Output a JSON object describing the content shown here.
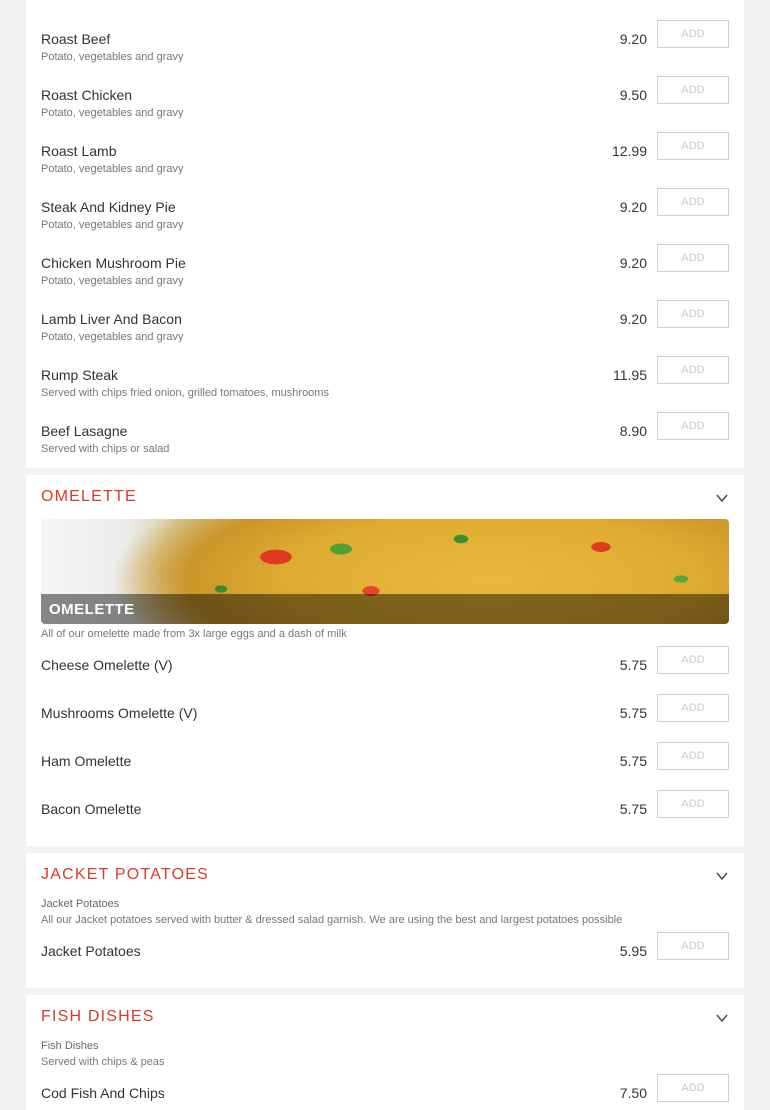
{
  "roast_section": {
    "items": [
      {
        "name": "Roast Beef",
        "desc": "Potato, vegetables and gravy",
        "price": "9.20",
        "add": "ADD"
      },
      {
        "name": "Roast Chicken",
        "desc": "Potato, vegetables and gravy",
        "price": "9.50",
        "add": "ADD"
      },
      {
        "name": "Roast Lamb",
        "desc": "Potato, vegetables and gravy",
        "price": "12.99",
        "add": "ADD"
      },
      {
        "name": "Steak And Kidney Pie",
        "desc": "Potato, vegetables and gravy",
        "price": "9.20",
        "add": "ADD"
      },
      {
        "name": "Chicken Mushroom Pie",
        "desc": "Potato, vegetables and gravy",
        "price": "9.20",
        "add": "ADD"
      },
      {
        "name": "Lamb Liver And Bacon",
        "desc": "Potato, vegetables and gravy",
        "price": "9.20",
        "add": "ADD"
      },
      {
        "name": "Rump Steak",
        "desc": "Served with chips fried onion, grilled tomatoes, mushrooms",
        "price": "11.95",
        "add": "ADD"
      },
      {
        "name": "Beef Lasagne",
        "desc": "Served with chips or salad",
        "price": "8.90",
        "add": "ADD"
      }
    ]
  },
  "omelette_section": {
    "title": "OMELETTE",
    "banner_title": "OMELETTE",
    "intro": "All of our omelette made from 3x large eggs and a dash of milk",
    "items": [
      {
        "name": "Cheese Omelette (V)",
        "price": "5.75",
        "add": "ADD"
      },
      {
        "name": "Mushrooms Omelette (V)",
        "price": "5.75",
        "add": "ADD"
      },
      {
        "name": "Ham Omelette",
        "price": "5.75",
        "add": "ADD"
      },
      {
        "name": "Bacon Omelette",
        "price": "5.75",
        "add": "ADD"
      }
    ]
  },
  "jacket_section": {
    "title": "JACKET POTATOES",
    "intro_title": "Jacket Potatoes",
    "intro": "All our Jacket potatoes served with butter & dressed salad garnish. We are using the best and largest potatoes possible",
    "items": [
      {
        "name": "Jacket Potatoes",
        "price": "5.95",
        "add": "ADD"
      }
    ]
  },
  "fish_section": {
    "title": "FISH DISHES",
    "intro_title": "Fish Dishes",
    "intro": "Served with chips & peas",
    "items": [
      {
        "name": "Cod Fish And Chips",
        "price": "7.50",
        "add": "ADD"
      }
    ]
  },
  "icons": {
    "chevron": "chevron-down-icon"
  },
  "colors": {
    "section_title": "#d93a2b",
    "background": "#f2f2f2",
    "card": "#ffffff"
  }
}
